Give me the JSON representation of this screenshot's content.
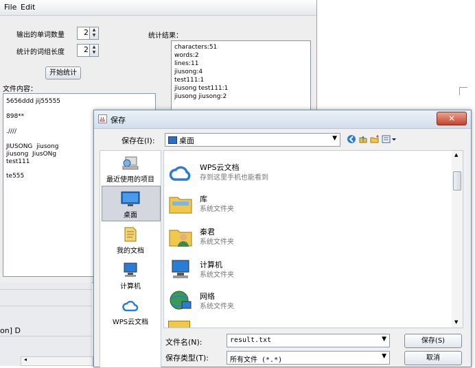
{
  "menubar": {
    "file": "File",
    "edit": "Edit"
  },
  "controls": {
    "word_count_label": "输出的单词数量",
    "word_count_value": "2",
    "phrase_length_label": "统计的词组长度",
    "phrase_length_value": "2",
    "start_button": "开始统计",
    "result_label": "统计结果：",
    "content_label": "文件内容："
  },
  "results": [
    "characters:51",
    "words:2",
    "lines:11",
    "jiusong:4",
    "test111:1",
    "jiusong test111:1",
    "jiusong jiusong:2"
  ],
  "file_content": [
    "5656ddd jij55555",
    "",
    "898**",
    "",
    ".////",
    "",
    "JIUSONG  jiusong",
    "jiusong  JiusONg",
    "test111",
    "",
    "te555"
  ],
  "background_fragment": "on] D",
  "dialog": {
    "title": "保存",
    "save_in_label": "保存在(I):",
    "save_in_value": "桌面",
    "places": [
      {
        "label": "最近使用的项目",
        "icon": "recent-items-icon"
      },
      {
        "label": "桌面",
        "icon": "desktop-icon"
      },
      {
        "label": "我的文档",
        "icon": "my-documents-icon"
      },
      {
        "label": "计算机",
        "icon": "computer-icon"
      },
      {
        "label": "WPS云文档",
        "icon": "wps-cloud-icon"
      }
    ],
    "files": [
      {
        "name": "WPS云文档",
        "type": "存到这里手机也能看到",
        "icon": "wps-cloud-icon"
      },
      {
        "name": "库",
        "type": "系统文件夹",
        "icon": "library-folder-icon"
      },
      {
        "name": "秦君",
        "type": "系统文件夹",
        "icon": "user-folder-icon"
      },
      {
        "name": "计算机",
        "type": "系统文件夹",
        "icon": "computer-icon"
      },
      {
        "name": "网络",
        "type": "系统文件夹",
        "icon": "network-icon"
      }
    ],
    "filename_label": "文件名(N):",
    "filename_value": "result.txt",
    "filetype_label": "保存类型(T):",
    "filetype_value": "所有文件 (*.*)",
    "save_button": "保存(S)",
    "cancel_button": "取消"
  },
  "colors": {
    "accent": "#2a7dd6",
    "close": "#c7412a"
  }
}
